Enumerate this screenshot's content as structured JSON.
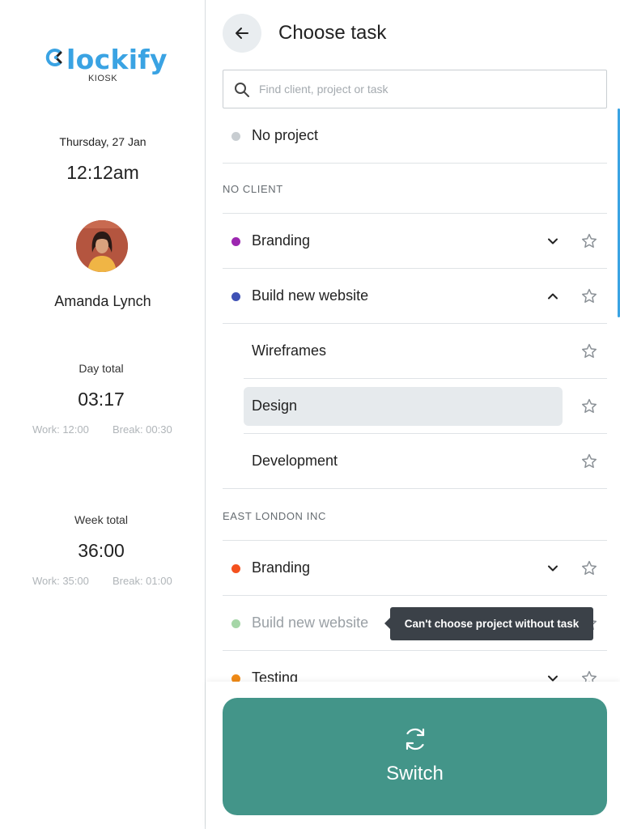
{
  "brand": {
    "logo_text": "Clockify",
    "subtitle": "KIOSK",
    "logo_color": "#3aa3e3"
  },
  "clock": {
    "date": "Thursday, 27 Jan",
    "time": "12:12am"
  },
  "user": {
    "name": "Amanda Lynch"
  },
  "day_total": {
    "label": "Day total",
    "value": "03:17",
    "work": "Work: 12:00",
    "break": "Break: 00:30"
  },
  "week_total": {
    "label": "Week total",
    "value": "36:00",
    "work": "Work: 35:00",
    "break": "Break: 01:00"
  },
  "header": {
    "title": "Choose task"
  },
  "search": {
    "placeholder": "Find client, project or task",
    "value": ""
  },
  "no_project": {
    "label": "No project",
    "color": "#c8cdd1"
  },
  "sections": [
    {
      "name": "NO CLIENT"
    },
    {
      "name": "EAST LONDON INC"
    }
  ],
  "projects": {
    "branding_1": {
      "label": "Branding",
      "color": "#9c27b0"
    },
    "build_1": {
      "label": "Build new website",
      "color": "#3f51b5"
    },
    "branding_2": {
      "label": "Branding",
      "color": "#f4511e"
    },
    "build_2": {
      "label": "Build new website",
      "color": "#a5d6a7"
    },
    "testing": {
      "label": "Testing",
      "color": "#ef8a17"
    }
  },
  "tasks": [
    "Wireframes",
    "Design",
    "Development"
  ],
  "tooltip": "Can't choose project without task",
  "switch_button": {
    "label": "Switch",
    "color": "#439589"
  }
}
